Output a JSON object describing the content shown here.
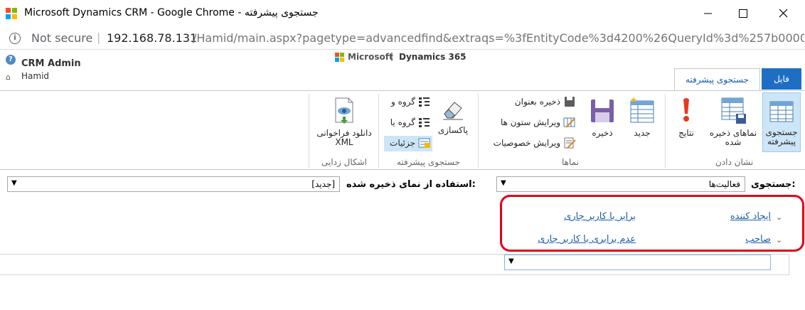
{
  "window": {
    "title": "Microsoft Dynamics CRM - Google Chrome - جستجوی پیشرفته"
  },
  "address_bar": {
    "security_label": "Not secure",
    "url_host": "192.168.78.131",
    "url_path": "/Hamid/main.aspx?pagetype=advancedfind&extraqs=%3fEntityCode%3d4200%26QueryId%3d%257b0000..."
  },
  "header": {
    "user_name": "CRM Admin",
    "org_name": "Hamid",
    "brand_microsoft": "Microsoft",
    "brand_separator": "|",
    "brand_product": "Dynamics 365"
  },
  "ribbon": {
    "tabs": [
      {
        "label": "فایل",
        "active": false
      },
      {
        "label": "جستجوی پیشرفته",
        "active": true
      }
    ],
    "groups": {
      "show": {
        "label": "نشان دادن",
        "buttons": [
          {
            "label_line1": "جستجوی",
            "label_line2": "پیشرفته",
            "icon": "advanced-find-icon",
            "active": true
          },
          {
            "label_line1": "نماهای ذخیره",
            "label_line2": "شده",
            "icon": "saved-views-icon"
          },
          {
            "label_line1": "نتایج",
            "label_line2": "",
            "icon": "results-icon"
          }
        ]
      },
      "views": {
        "label": "نماها",
        "buttons": [
          {
            "label": "جدید",
            "icon": "new-view-icon"
          },
          {
            "label": "ذخیره",
            "icon": "save-icon"
          }
        ],
        "small_buttons": [
          {
            "label": "ذخیره بعنوان",
            "icon": "save-as-icon"
          },
          {
            "label": "ویرایش ستون ها",
            "icon": "edit-columns-icon"
          },
          {
            "label": "ویرایش خصوصیات",
            "icon": "edit-properties-icon"
          }
        ]
      },
      "query": {
        "label": "جستجوی پیشرفته",
        "buttons": [
          {
            "label": "پاکسازی",
            "icon": "eraser-icon"
          }
        ],
        "small_buttons": [
          {
            "label": "گروه و",
            "icon": "group-and-icon"
          },
          {
            "label": "گروه یا",
            "icon": "group-or-icon"
          },
          {
            "label": "جزئیات",
            "icon": "details-icon",
            "active": true
          }
        ]
      },
      "debug": {
        "label": "اشکال زدایی",
        "buttons": [
          {
            "label_line1": "دانلود فراخوانی",
            "label_line2": "XML",
            "icon": "download-xml-icon"
          }
        ]
      }
    }
  },
  "query": {
    "look_for_label": "جستجوی:",
    "look_for_value": "فعالیت‌ها",
    "use_saved_label": "استفاده از نمای ذخیره شده:",
    "use_saved_value": "[جدید]",
    "conditions": [
      {
        "field": "ایجاد کننده",
        "operator": "برابر با کاربر جاری"
      },
      {
        "field": "صاحب",
        "operator": "عدم برابری با کاربر جاری"
      }
    ],
    "new_row_value": ""
  },
  "colors": {
    "accent": "#1e6fc4",
    "link": "#1a5ca8",
    "highlight": "#e3001b",
    "active_button_bg": "#cde6f7"
  }
}
